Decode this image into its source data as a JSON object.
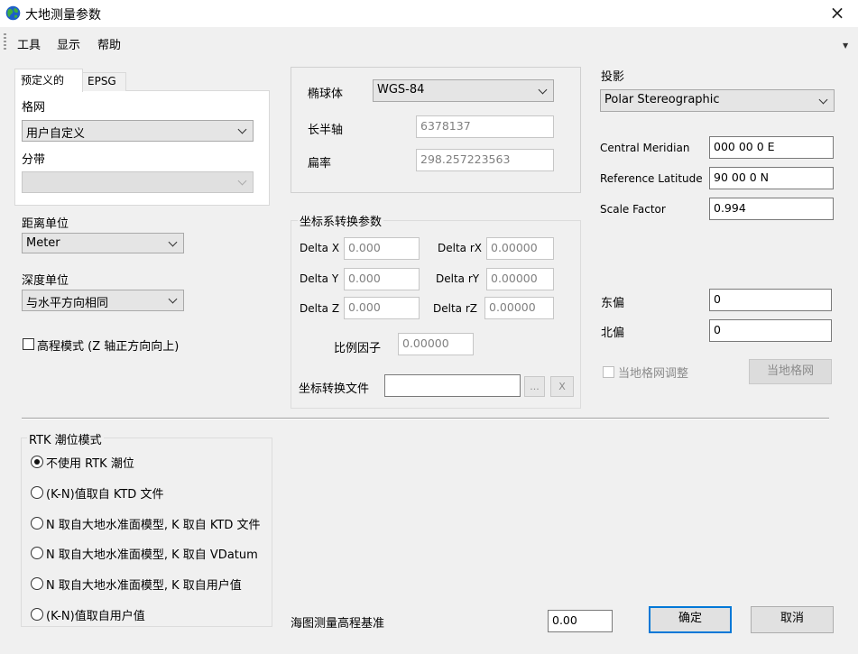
{
  "window": {
    "title": "大地测量参数",
    "close_glyph": "×",
    "icon": "globe-icon"
  },
  "menu": {
    "items": [
      "工具",
      "显示",
      "帮助"
    ],
    "overflow_glyph": "▼"
  },
  "tabs": {
    "predefined": "预定义的",
    "epsg": "EPSG"
  },
  "grid": {
    "label": "格网",
    "value": "用户自定义"
  },
  "zone": {
    "label": "分带",
    "value": ""
  },
  "distance_unit": {
    "label": "距离单位",
    "value": "Meter"
  },
  "depth_unit": {
    "label": "深度单位",
    "value": "与水平方向相同"
  },
  "elevation_mode": {
    "label": "高程模式 (Z 轴正方向向上)",
    "checked": false
  },
  "ellipsoid": {
    "label": "椭球体",
    "value": "WGS-84",
    "semi_major_label": "长半轴",
    "semi_major": "6378137",
    "flattening_label": "扁率",
    "flattening": "298.257223563"
  },
  "transform": {
    "legend": "坐标系转换参数",
    "delta_x_label": "Delta X",
    "delta_x": "0.000",
    "delta_y_label": "Delta Y",
    "delta_y": "0.000",
    "delta_z_label": "Delta Z",
    "delta_z": "0.000",
    "delta_rx_label": "Delta rX",
    "delta_rx": "0.00000",
    "delta_ry_label": "Delta rY",
    "delta_ry": "0.00000",
    "delta_rz_label": "Delta rZ",
    "delta_rz": "0.00000",
    "scale_label": "比例因子",
    "scale": "0.00000",
    "file_label": "坐标转换文件",
    "file": "",
    "browse_label": "...",
    "clear_label": "X"
  },
  "projection": {
    "label": "投影",
    "value": "Polar Stereographic",
    "central_meridian_label": "Central Meridian",
    "central_meridian": "000 00 0 E",
    "ref_latitude_label": "Reference Latitude",
    "ref_latitude": "90 00 0 N",
    "scale_factor_label": "Scale Factor",
    "scale_factor": "0.994",
    "false_easting_label": "东偏",
    "false_easting": "0",
    "false_northing_label": "北偏",
    "false_northing": "0",
    "local_grid_adjust_label": "当地格网调整",
    "local_grid_button": "当地格网"
  },
  "rtk": {
    "legend": "RTK 潮位模式",
    "options": [
      "不使用 RTK 潮位",
      "(K-N)值取自 KTD 文件",
      "N 取自大地水准面模型, K 取自 KTD 文件",
      "N 取自大地水准面模型,  K 取自 VDatum",
      "N 取自大地水准面模型, K 取自用户值",
      "(K-N)值取自用户值"
    ],
    "selected": 0
  },
  "chart_datum": {
    "label": "海图测量高程基准",
    "value": "0.00"
  },
  "buttons": {
    "ok": "确定",
    "cancel": "取消"
  }
}
